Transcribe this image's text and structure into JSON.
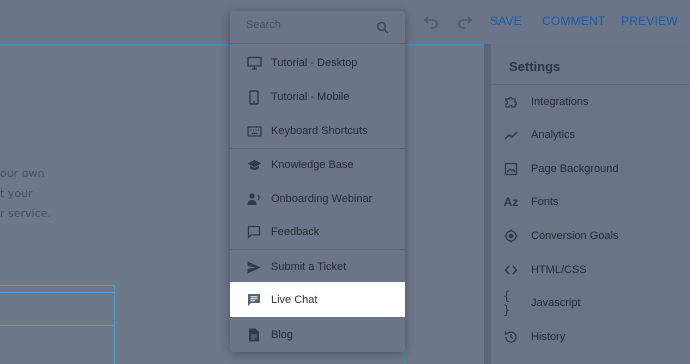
{
  "toolbar": {
    "save_label": "SAVE",
    "comment_label": "COMMENT",
    "preview_label": "PREVIEW",
    "undo_icon": "undo-icon",
    "redo_icon": "redo-icon",
    "accent_color": "#1a5ca8"
  },
  "canvas": {
    "text_lines": [
      "our own",
      "t your",
      "r service."
    ]
  },
  "help_menu": {
    "search_placeholder": "Search",
    "items": [
      {
        "label": "Tutorial - Desktop",
        "icon": "desktop-icon"
      },
      {
        "label": "Tutorial - Mobile",
        "icon": "mobile-icon"
      },
      {
        "label": "Keyboard Shortcuts",
        "icon": "keyboard-icon"
      },
      {
        "label": "Knowledge Base",
        "icon": "graduation-cap-icon"
      },
      {
        "label": "Onboarding Webinar",
        "icon": "webinar-icon"
      },
      {
        "label": "Feedback",
        "icon": "comment-icon"
      },
      {
        "label": "Submit a Ticket",
        "icon": "send-icon"
      },
      {
        "label": "Live Chat",
        "icon": "chat-icon",
        "highlighted": true
      },
      {
        "label": "Blog",
        "icon": "document-icon"
      }
    ]
  },
  "settings": {
    "title": "Settings",
    "items": [
      {
        "label": "Integrations",
        "icon": "puzzle-icon"
      },
      {
        "label": "Analytics",
        "icon": "trend-icon"
      },
      {
        "label": "Page Background",
        "icon": "image-icon"
      },
      {
        "label": "Fonts",
        "icon": "font-icon"
      },
      {
        "label": "Conversion Goals",
        "icon": "target-icon"
      },
      {
        "label": "HTML/CSS",
        "icon": "code-icon"
      },
      {
        "label": "Javascript",
        "icon": "braces-icon"
      },
      {
        "label": "History",
        "icon": "history-icon"
      }
    ]
  }
}
